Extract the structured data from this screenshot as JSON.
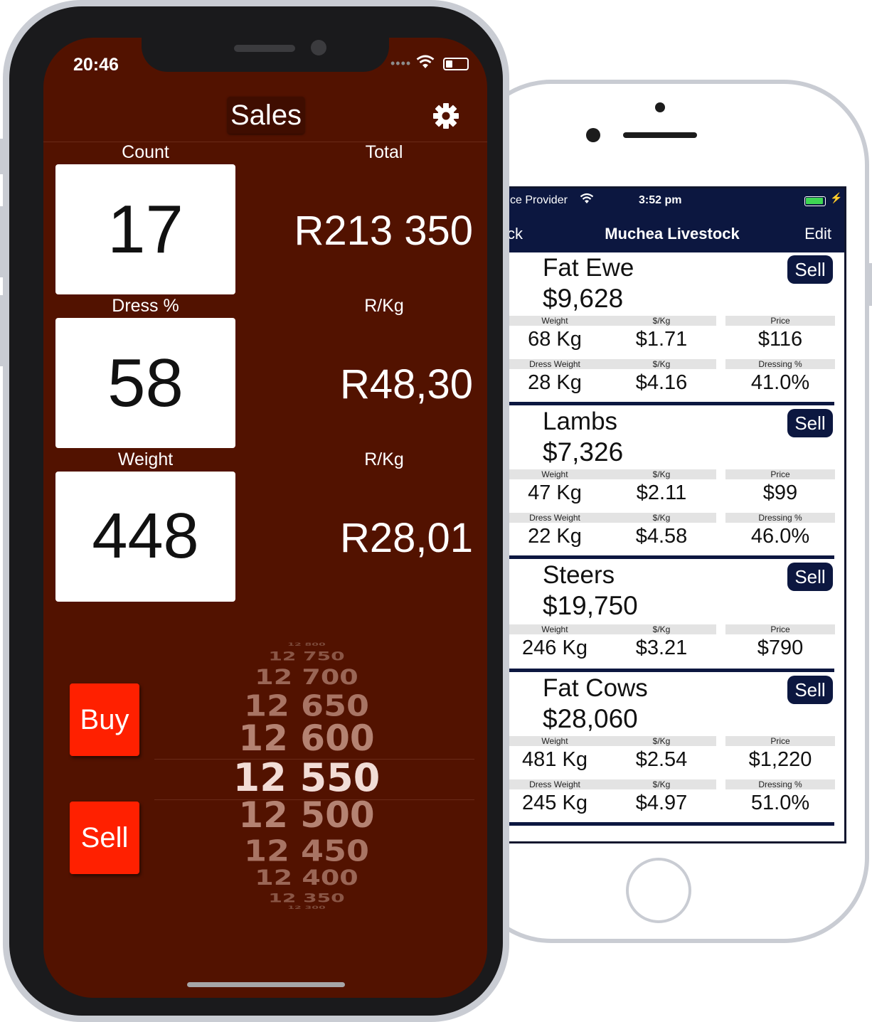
{
  "back_phone": {
    "status": {
      "carrier": "ce Provider",
      "time": "3:52 pm"
    },
    "nav": {
      "back": "ck",
      "title": "Muchea Livestock",
      "edit": "Edit"
    },
    "labels": {
      "weight": "Weight",
      "per_kg": "$/Kg",
      "price": "Price",
      "dress_weight": "Dress Weight",
      "dressing": "Dressing %",
      "sell": "Sell"
    },
    "cards": [
      {
        "name": "Fat Ewe",
        "total": "$9,628",
        "weight": "68 Kg",
        "per_kg": "$1.71",
        "price": "$116",
        "dress_weight": "28 Kg",
        "dress_per_kg": "$4.16",
        "dressing": "41.0%"
      },
      {
        "name": "Lambs",
        "total": "$7,326",
        "weight": "47 Kg",
        "per_kg": "$2.11",
        "price": "$99",
        "dress_weight": "22 Kg",
        "dress_per_kg": "$4.58",
        "dressing": "46.0%"
      },
      {
        "name": "Steers",
        "total": "$19,750",
        "weight": "246 Kg",
        "per_kg": "$3.21",
        "price": "$790"
      },
      {
        "name": "Fat Cows",
        "total": "$28,060",
        "weight": "481 Kg",
        "per_kg": "$2.54",
        "price": "$1,220",
        "dress_weight": "245 Kg",
        "dress_per_kg": "$4.97",
        "dressing": "51.0%"
      }
    ]
  },
  "front_phone": {
    "status": {
      "time": "20:46"
    },
    "title": "Sales",
    "labels": {
      "count": "Count",
      "total": "Total",
      "dress": "Dress %",
      "rkg": "R/Kg",
      "weight": "Weight"
    },
    "values": {
      "count": "17",
      "total": "R213 350",
      "dress": "58",
      "dress_rkg": "R48,30",
      "weight": "448",
      "weight_rkg": "R28,01"
    },
    "buttons": {
      "buy": "Buy",
      "sell": "Sell"
    },
    "picker": {
      "selected": "12 550",
      "items": [
        "12 800",
        "12 750",
        "12 700",
        "12 650",
        "12 600",
        "12 550",
        "12 500",
        "12 450",
        "12 400",
        "12 350",
        "12 300"
      ]
    }
  }
}
